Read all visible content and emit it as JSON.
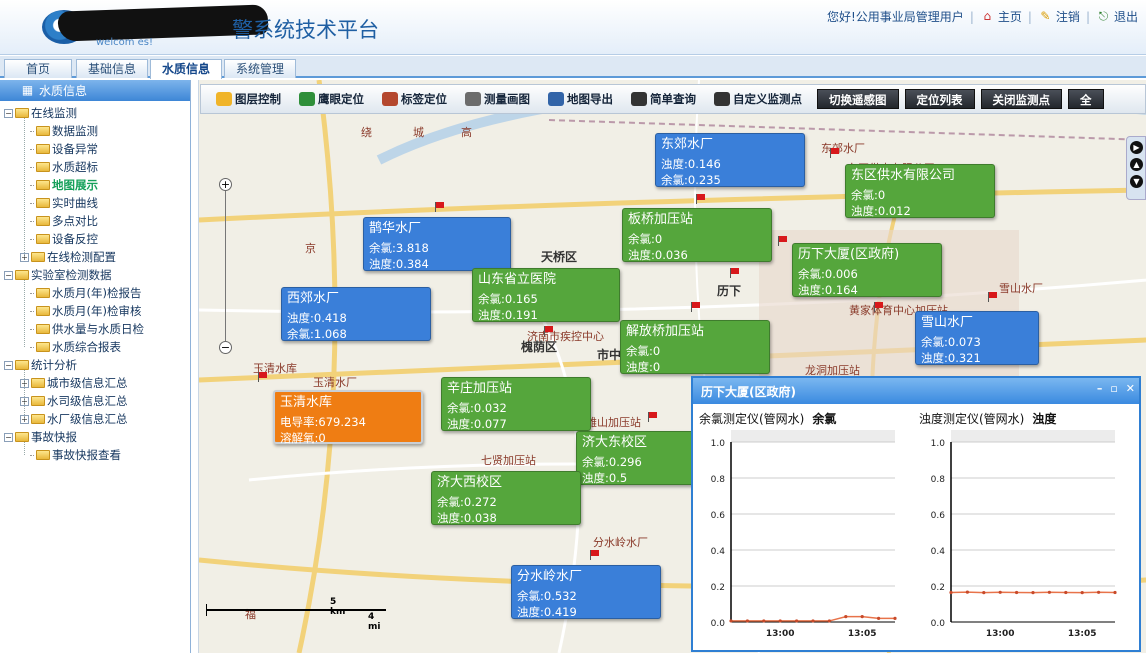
{
  "header": {
    "logo_sub": "welcom                 es!",
    "title": "警系统技术平台",
    "greeting": "您好!公用事业局管理用户",
    "home_label": "主页",
    "logout_label": "注销",
    "exit_label": "退出"
  },
  "tabs": [
    "首页",
    "基础信息",
    "水质信息",
    "系统管理"
  ],
  "sidebar": {
    "heading": "水质信息",
    "groups": [
      {
        "label": "在线监测",
        "items": [
          "数据监测",
          "设备异常",
          "水质超标",
          "地图展示",
          "实时曲线",
          "多点对比",
          "设备反控",
          "在线检测配置"
        ]
      },
      {
        "label": "实验室检测数据",
        "items": [
          "水质月(年)检报告",
          "水质月(年)检审核",
          "供水量与水质日检",
          "水质综合报表"
        ]
      },
      {
        "label": "统计分析",
        "items": [
          "城市级信息汇总",
          "水司级信息汇总",
          "水厂级信息汇总"
        ]
      },
      {
        "label": "事故快报",
        "items": [
          "事故快报查看"
        ]
      }
    ]
  },
  "toolbar": {
    "tools": [
      "图层控制",
      "鹰眼定位",
      "标签定位",
      "测量画图",
      "地图导出",
      "简单查询",
      "自定义监测点"
    ],
    "buttons": [
      "切换遥感图",
      "定位列表",
      "关闭监测点",
      "全"
    ]
  },
  "map": {
    "labels": [
      "天桥区",
      "槐荫区",
      "市中",
      "历下",
      "山东省立医院",
      "玉清水库",
      "东郊水厂",
      "东区供水有限公司",
      "雪山水厂",
      "黄家体育中心加压站",
      "龙洞加压站",
      "分水岭水厂",
      "七贤加压站",
      "济大东校区",
      "济南市疾控中心",
      "英雄山加压站",
      "玉清水厂",
      "绕",
      "城",
      "高",
      "京",
      "福",
      "5 km",
      "4 mi"
    ],
    "popups": [
      {
        "title": "东郊水厂",
        "l1": "浊度:0.146",
        "l2": "余氯:0.235",
        "color": "blue"
      },
      {
        "title": "东区供水有限公司",
        "l1": "余氯:0",
        "l2": "浊度:0.012",
        "color": "green"
      },
      {
        "title": "板桥加压站",
        "l1": "余氯:0",
        "l2": "浊度:0.036",
        "color": "green"
      },
      {
        "title": "鹊华水厂",
        "l1": "余氯:3.818",
        "l2": "浊度:0.384",
        "color": "blue"
      },
      {
        "title": "历下大厦(区政府)",
        "l1": "余氯:0.006",
        "l2": "浊度:0.164",
        "color": "green"
      },
      {
        "title": "山东省立医院",
        "l1": "余氯:0.165",
        "l2": "浊度:0.191",
        "color": "green"
      },
      {
        "title": "西郊水厂",
        "l1": "浊度:0.418",
        "l2": "余氯:1.068",
        "color": "blue"
      },
      {
        "title": "解放桥加压站",
        "l1": "余氯:0",
        "l2": "浊度:0",
        "color": "green"
      },
      {
        "title": "雪山水厂",
        "l1": "余氯:0.073",
        "l2": "浊度:0.321",
        "color": "blue"
      },
      {
        "title": "玉清水库",
        "l1": "电导率:679.234",
        "l2": "溶解氧:0",
        "color": "orange"
      },
      {
        "title": "辛庄加压站",
        "l1": "余氯:0.032",
        "l2": "浊度:0.077",
        "color": "green"
      },
      {
        "title": "济大东校区",
        "l1": "余氯:0.296",
        "l2": "浊度:0.5",
        "color": "green"
      },
      {
        "title": "济大西校区",
        "l1": "余氯:0.272",
        "l2": "浊度:0.038",
        "color": "green"
      },
      {
        "title": "分水岭水厂",
        "l1": "余氯:0.532",
        "l2": "浊度:0.419",
        "color": "blue"
      }
    ]
  },
  "chart_window": {
    "title": "历下大厦(区政府)",
    "left_label": "余氯测定仪(管网水)",
    "left_series": "余氯",
    "right_label": "浊度测定仪(管网水)",
    "right_series": "浊度"
  },
  "chart_data": [
    {
      "type": "line",
      "title": "余氯测定仪(管网水)",
      "x": [
        "12:57",
        "12:58",
        "12:59",
        "13:00",
        "13:01",
        "13:02",
        "13:03",
        "13:04",
        "13:05",
        "13:06",
        "13:07"
      ],
      "series": [
        {
          "name": "余氯",
          "values": [
            0.006,
            0.006,
            0.006,
            0.006,
            0.006,
            0.006,
            0.006,
            0.03,
            0.03,
            0.02,
            0.02
          ]
        }
      ],
      "yticks": [
        "0.0",
        "0.2",
        "0.4",
        "0.6",
        "0.8",
        "1.0"
      ],
      "xticks": [
        "13:00",
        "13:05"
      ],
      "ylim": [
        0,
        1.0
      ]
    },
    {
      "type": "line",
      "title": "浊度测定仪(管网水)",
      "x": [
        "12:57",
        "12:58",
        "12:59",
        "13:00",
        "13:01",
        "13:02",
        "13:03",
        "13:04",
        "13:05",
        "13:06",
        "13:07"
      ],
      "series": [
        {
          "name": "浊度",
          "values": [
            0.164,
            0.166,
            0.163,
            0.165,
            0.164,
            0.163,
            0.165,
            0.164,
            0.163,
            0.165,
            0.164
          ]
        }
      ],
      "yticks": [
        "0.0",
        "0.2",
        "0.4",
        "0.6",
        "0.8",
        "1.0"
      ],
      "xticks": [
        "13:00",
        "13:05"
      ],
      "ylim": [
        0,
        1.0
      ]
    }
  ]
}
